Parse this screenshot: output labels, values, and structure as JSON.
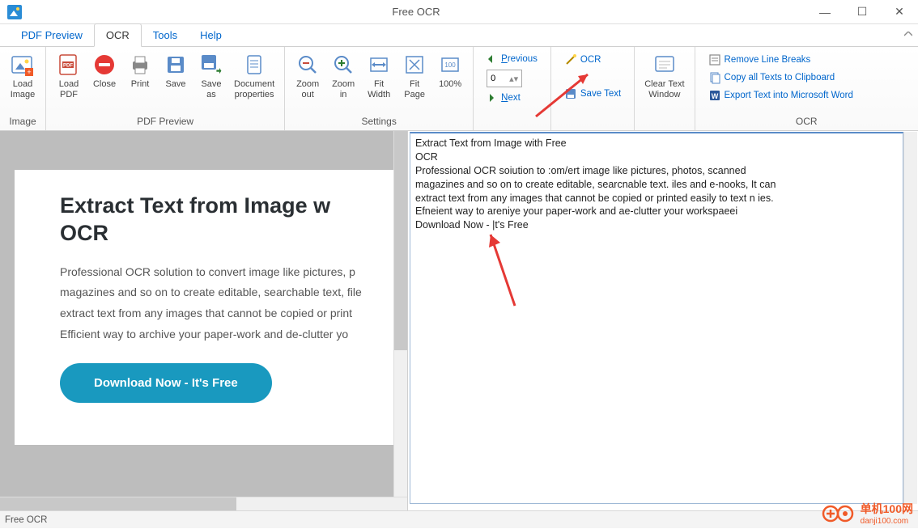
{
  "window": {
    "title": "Free OCR",
    "min": "—",
    "max": "☐",
    "close": "✕"
  },
  "menu": {
    "tabs": [
      "PDF Preview",
      "OCR",
      "Tools",
      "Help"
    ],
    "active": 1
  },
  "ribbon": {
    "groups": {
      "image": {
        "label": "Image",
        "load_image": "Load\nImage"
      },
      "pdf_preview": {
        "label": "PDF Preview",
        "load_pdf": "Load\nPDF",
        "close": "Close",
        "print": "Print",
        "save": "Save",
        "save_as": "Save\nas",
        "doc_props": "Document\nproperties"
      },
      "settings": {
        "label": "Settings",
        "zoom_out": "Zoom\nout",
        "zoom_in": "Zoom\nin",
        "fit_width": "Fit\nWidth",
        "fit_page": "Fit\nPage",
        "hundred": "100%"
      },
      "nav": {
        "previous": "Previous",
        "next": "Next",
        "spinner_value": "0"
      },
      "ocr_actions": {
        "ocr": "OCR",
        "save_text": "Save Text",
        "clear": "Clear Text\nWindow"
      },
      "ocr": {
        "label": "OCR",
        "remove_breaks": "Remove Line Breaks",
        "copy_all": "Copy all Texts to Clipboard",
        "export_word": "Export Text into Microsoft Word"
      }
    }
  },
  "preview": {
    "title_line1": "Extract Text from Image w",
    "title_line2": "OCR",
    "body_l1": "Professional OCR solution to convert image like pictures, p",
    "body_l2": "magazines and so on to create editable, searchable text, file",
    "body_l3": "extract text from any images that cannot be copied or print",
    "body_l4": "Efficient way to archive your paper-work and de-clutter yo",
    "download_btn": "Download Now - It's Free"
  },
  "ocr_output": {
    "l1": "Extract Text from Image with Free",
    "l2": "OCR",
    "l3": "Professional OCR soiution to :om/ert image like pictures, photos, scanned",
    "l4": "magazines and so on to create editable, searcnable text. iles and e-nooks, It can",
    "l5": "extract text from any images that cannot be copied or printed easily to text n ies.",
    "l6": "Efneient way to areniye your paper-work and ae-clutter your workspaeei",
    "l7": "Download Now - |t's Free"
  },
  "status": {
    "text": "Free OCR"
  },
  "watermark": {
    "name": "单机100网",
    "sub": "danji100.com"
  }
}
